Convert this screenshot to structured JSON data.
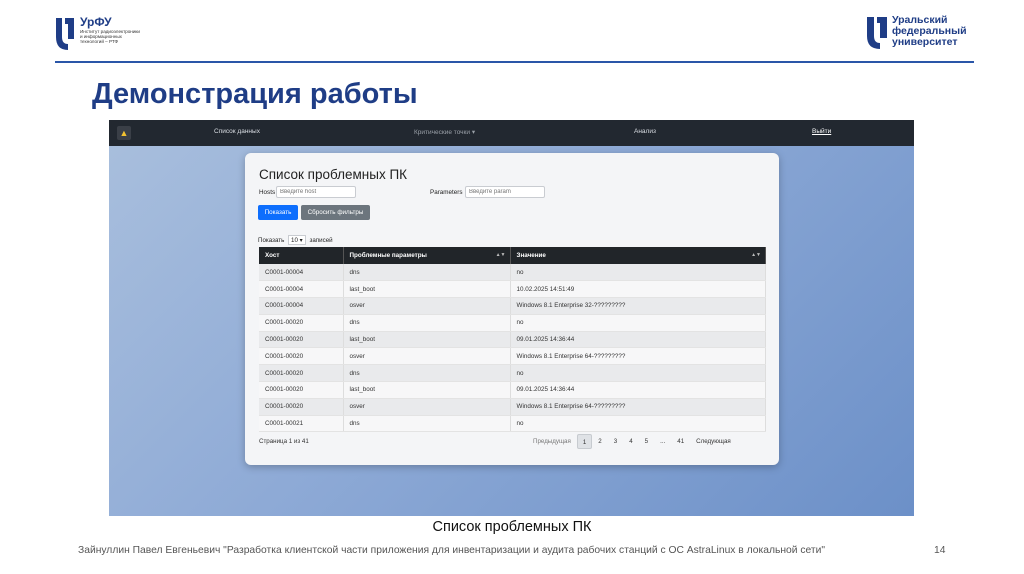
{
  "header": {
    "logo_left_brand": "УрФУ",
    "logo_left_sub": "Институт радиоэлектроники и информационных технологий – РТФ",
    "logo_right_text": [
      "Уральский",
      "федеральный",
      "университет"
    ],
    "title": "Демонстрация работы"
  },
  "app": {
    "navbar": {
      "brand_icon": "triangle-logo-icon",
      "items": [
        "Список данных",
        "Критические точки ▾",
        "Анализ"
      ],
      "exit": "Выйти"
    },
    "card": {
      "title": "Список проблемных ПК",
      "hosts_label": "Hosts",
      "hosts_placeholder": "Введите host",
      "params_label": "Parameters",
      "params_placeholder": "Введите param",
      "show_button": "Показать",
      "reset_button": "Сбросить фильтры",
      "show_prefix": "Показать",
      "page_size": "10",
      "show_suffix": "записей"
    },
    "table": {
      "columns": [
        "Хост",
        "Проблемные параметры",
        "Значение"
      ],
      "rows": [
        [
          "C0001-00004",
          "dns",
          "no"
        ],
        [
          "C0001-00004",
          "last_boot",
          "10.02.2025 14:51:49"
        ],
        [
          "C0001-00004",
          "osver",
          "Windows 8.1 Enterprise 32-?????????"
        ],
        [
          "C0001-00020",
          "dns",
          "no"
        ],
        [
          "C0001-00020",
          "last_boot",
          "09.01.2025 14:36:44"
        ],
        [
          "C0001-00020",
          "osver",
          "Windows 8.1 Enterprise 64-?????????"
        ],
        [
          "C0001-00020",
          "dns",
          "no"
        ],
        [
          "C0001-00020",
          "last_boot",
          "09.01.2025 14:36:44"
        ],
        [
          "C0001-00020",
          "osver",
          "Windows 8.1 Enterprise 64-?????????"
        ],
        [
          "C0001-00021",
          "dns",
          "no"
        ]
      ]
    },
    "pagination": {
      "info": "Страница 1 из 41",
      "prev": "Предыдущая",
      "pages": [
        "1",
        "2",
        "3",
        "4",
        "5",
        "...",
        "41"
      ],
      "next": "Следующая"
    }
  },
  "caption": "Список проблемных ПК",
  "footer": "Зайнуллин Павел Евгеньевич \"Разработка клиентской части приложения для инвентаризации и аудита рабочих станций с ОС AstraLinux в локальной сети\"",
  "page_number": "14",
  "colors": {
    "brand": "#1f3d86",
    "navbar": "#222830",
    "primary": "#0d6efd",
    "secondary": "#6c757d"
  }
}
